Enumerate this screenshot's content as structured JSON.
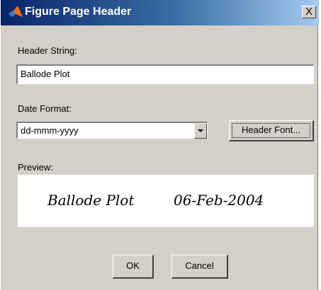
{
  "window": {
    "title": "Figure Page Header",
    "close_glyph": "X"
  },
  "header": {
    "label": "Header String:",
    "value": "Ballode Plot"
  },
  "date_format": {
    "label": "Date Format:",
    "selected": "dd-mmm-yyyy"
  },
  "buttons": {
    "header_font": "Header Font...",
    "ok": "OK",
    "cancel": "Cancel"
  },
  "preview": {
    "label": "Preview:",
    "header_text": "Ballode Plot",
    "date_text": "06-Feb-2004"
  },
  "colors": {
    "dialog_background": "#d4d0c8",
    "titlebar_start": "#0a246a",
    "titlebar_end": "#a6caf0"
  },
  "icons": {
    "app": "matlab-logo-icon"
  }
}
